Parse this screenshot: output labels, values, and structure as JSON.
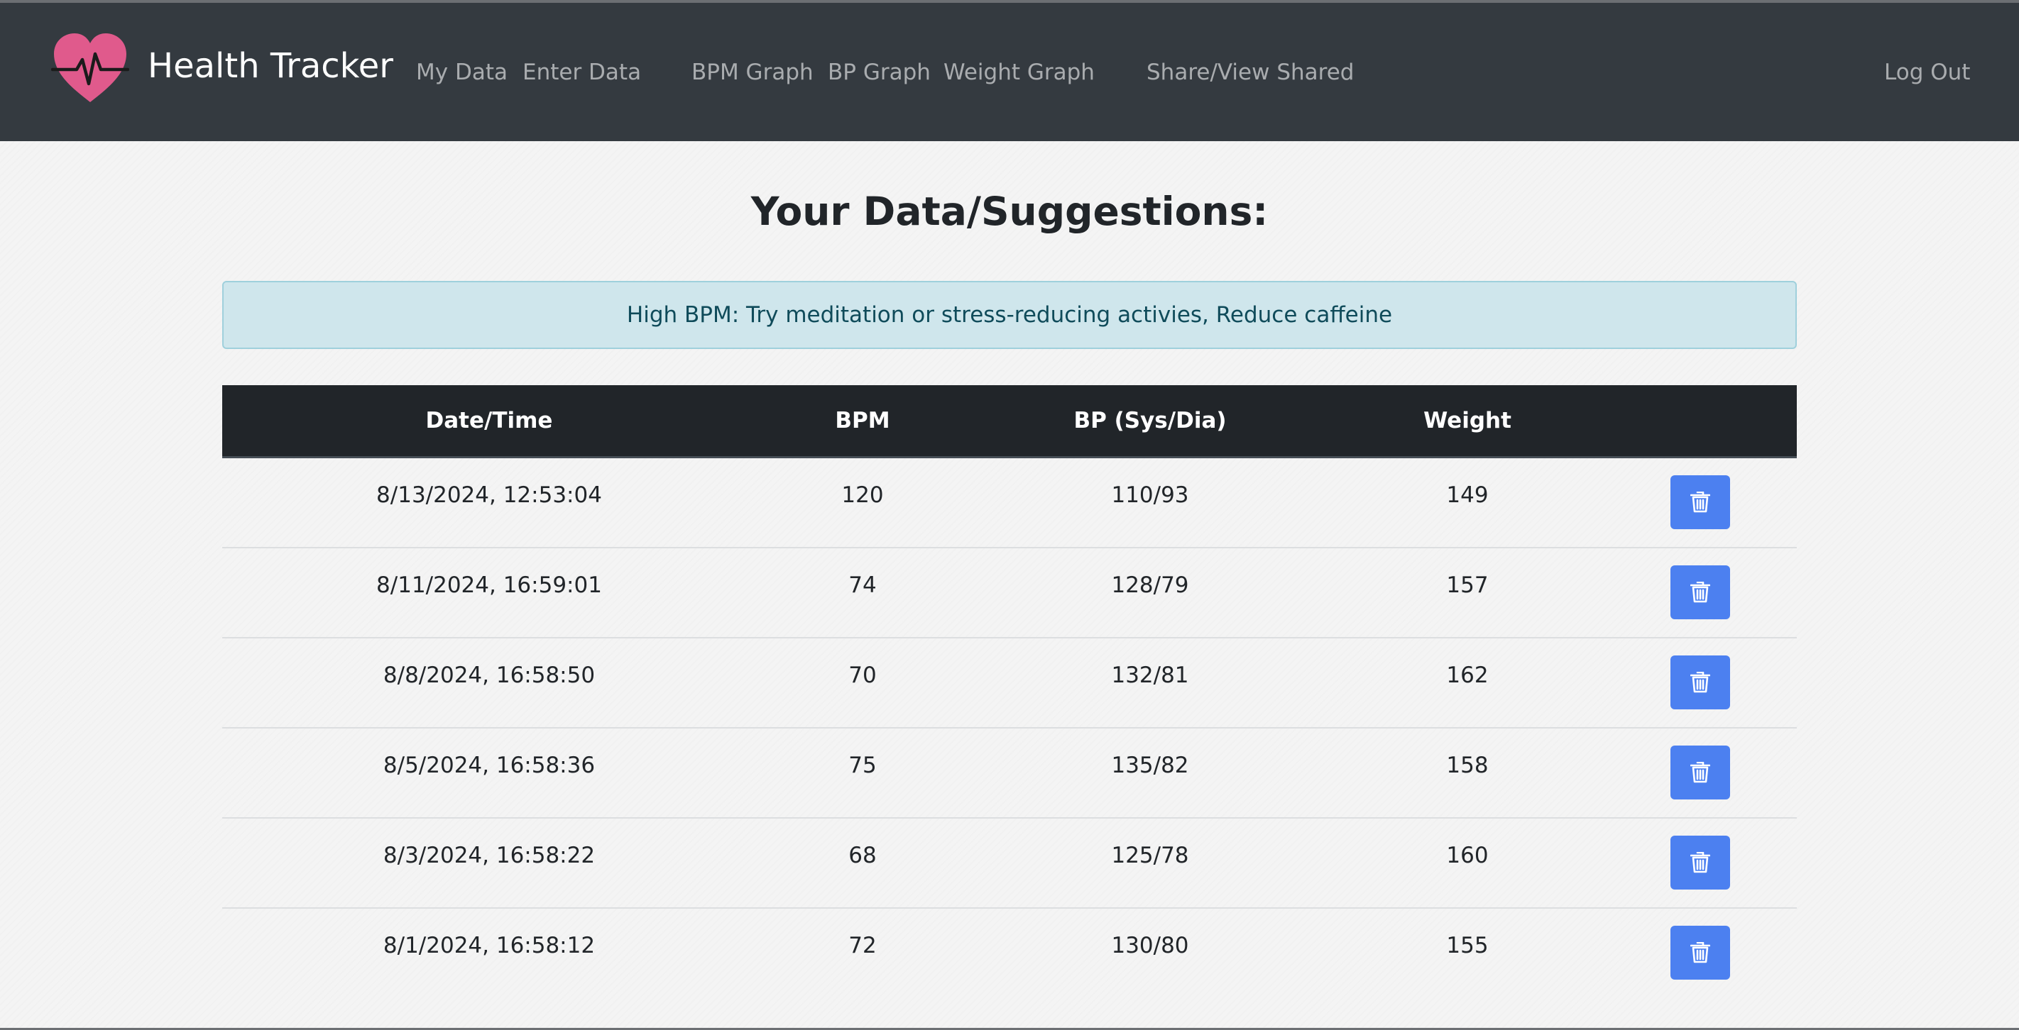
{
  "navbar": {
    "brand": "Health Tracker",
    "logo_icon": "heart-pulse-icon",
    "brand_color": "#e05a8c",
    "links": {
      "my_data": "My Data",
      "enter_data": "Enter Data",
      "bpm_graph": "BPM Graph",
      "bp_graph": "BP Graph",
      "weight_graph": "Weight Graph",
      "share": "Share/View Shared",
      "logout": "Log Out"
    }
  },
  "main": {
    "title": "Your Data/Suggestions:",
    "alert": "High BPM: Try meditation or stress-reducing activies, Reduce caffeine",
    "table": {
      "headers": [
        "Date/Time",
        "BPM",
        "BP (Sys/Dia)",
        "Weight",
        ""
      ],
      "rows": [
        {
          "datetime": "8/13/2024, 12:53:04",
          "bpm": "120",
          "bp": "110/93",
          "weight": "149"
        },
        {
          "datetime": "8/11/2024, 16:59:01",
          "bpm": "74",
          "bp": "128/79",
          "weight": "157"
        },
        {
          "datetime": "8/8/2024, 16:58:50",
          "bpm": "70",
          "bp": "132/81",
          "weight": "162"
        },
        {
          "datetime": "8/5/2024, 16:58:36",
          "bpm": "75",
          "bp": "135/82",
          "weight": "158"
        },
        {
          "datetime": "8/3/2024, 16:58:22",
          "bpm": "68",
          "bp": "125/78",
          "weight": "160"
        },
        {
          "datetime": "8/1/2024, 16:58:12",
          "bpm": "72",
          "bp": "130/80",
          "weight": "155"
        }
      ],
      "delete_icon": "trash-icon",
      "delete_color": "#4c80f0"
    }
  }
}
